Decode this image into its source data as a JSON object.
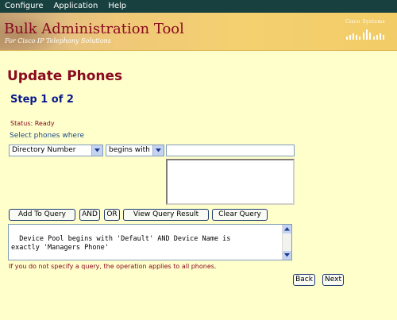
{
  "menu": {
    "items": [
      {
        "label": "Configure"
      },
      {
        "label": "Application"
      },
      {
        "label": "Help"
      }
    ]
  },
  "banner": {
    "title": "Bulk Administration Tool",
    "subtitle": "For Cisco IP Telephony Solutions",
    "logo_text": "Cisco Systems"
  },
  "page": {
    "title": "Update Phones",
    "step": "Step 1 of 2",
    "status": "Status: Ready",
    "select_label": "Select phones where"
  },
  "query_builder": {
    "field_select": "Directory Number",
    "operator_select": "begins with",
    "value_input": "",
    "add_button": "Add To Query",
    "and_button": "AND",
    "or_button": "OR",
    "view_button": "View Query Result",
    "clear_button": "Clear Query",
    "query_text": "Device Pool begins with 'Default' AND Device Name is\nexactly 'Managers Phone'"
  },
  "note": "If you do not specify a query, the operation applies to all phones.",
  "navigation": {
    "back": "Back",
    "next": "Next"
  },
  "colors": {
    "menubar": "#17403f",
    "accent": "#8a0a20",
    "heading_blue": "#0a1a8c",
    "background": "#ffffcc"
  }
}
